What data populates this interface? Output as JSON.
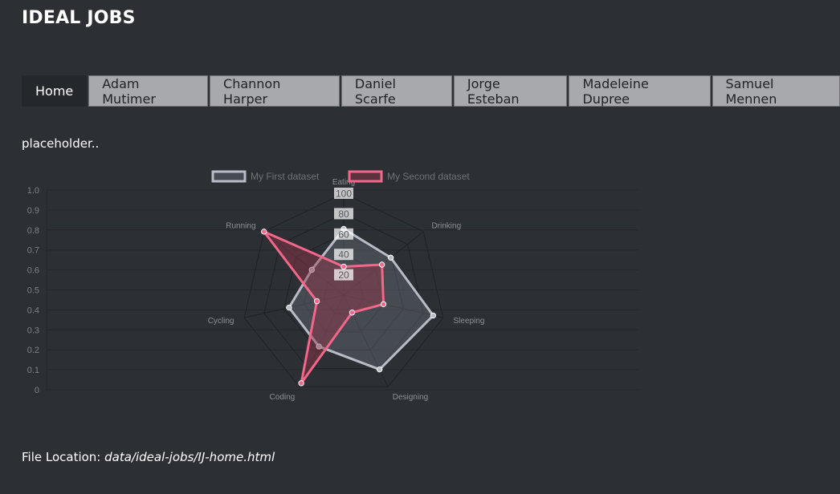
{
  "header": {
    "title": "IDEAL JOBS"
  },
  "tabs": [
    {
      "label": "Home",
      "active": true
    },
    {
      "label": "Adam Mutimer",
      "active": false
    },
    {
      "label": "Channon Harper",
      "active": false
    },
    {
      "label": "Daniel Scarfe",
      "active": false
    },
    {
      "label": "Jorge Esteban",
      "active": false
    },
    {
      "label": "Madeleine Dupree",
      "active": false
    },
    {
      "label": "Samuel Mennen",
      "active": false
    }
  ],
  "main": {
    "placeholder": "placeholder.."
  },
  "chart_data": {
    "type": "radar",
    "labels": [
      "Eating",
      "Drinking",
      "Sleeping",
      "Designing",
      "Coding",
      "Cycling",
      "Running"
    ],
    "series": [
      {
        "name": "My First dataset",
        "values": [
          65,
          59,
          90,
          81,
          56,
          55,
          40
        ],
        "color": "#b8bcc6",
        "fill": "rgba(120,125,138,0.35)"
      },
      {
        "name": "My Second dataset",
        "values": [
          28,
          48,
          40,
          19,
          96,
          27,
          100
        ],
        "color": "#f2678a",
        "fill": "rgba(150,55,75,0.45)"
      }
    ],
    "r_ticks": [
      "20",
      "40",
      "60",
      "80",
      "100"
    ],
    "y_ticks": [
      "0",
      "0.1",
      "0.2",
      "0.3",
      "0.4",
      "0.5",
      "0.6",
      "0.7",
      "0.8",
      "0.9",
      "1.0"
    ],
    "ylim": [
      0,
      1
    ],
    "rlim": [
      0,
      100
    ],
    "grid": true,
    "legend": "top"
  },
  "footer": {
    "label": "File Location:",
    "path": "data/ideal-jobs/IJ-home.html"
  }
}
